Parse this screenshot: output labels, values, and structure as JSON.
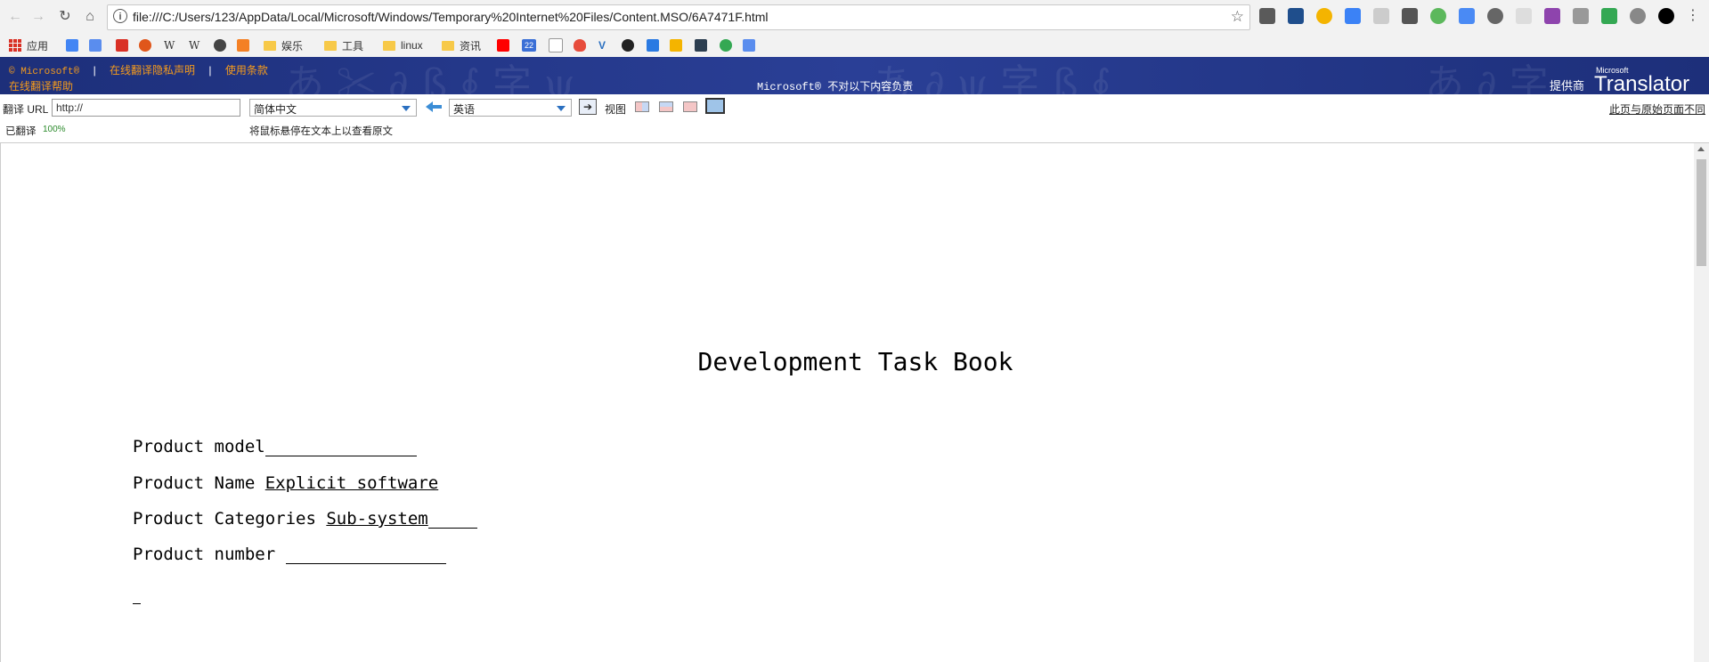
{
  "browser": {
    "url": "file:///C:/Users/123/AppData/Local/Microsoft/Windows/Temporary%20Internet%20Files/Content.MSO/6A7471F.html",
    "bookmarks": [
      "应用",
      "娱乐",
      "工具",
      "linux",
      "资讯"
    ],
    "calendar_badge": "22"
  },
  "translator": {
    "copyright": "© Microsoft®",
    "privacy": "在线翻译隐私声明",
    "terms": "使用条款",
    "help": "在线翻译帮助",
    "disclaimer": "Microsoft® 不对以下内容负责",
    "provider": "提供商",
    "brand_small": "Microsoft",
    "brand": "Translator",
    "url_label": "翻译 URL",
    "url_value": "http://",
    "from_lang": "简体中文",
    "to_lang": "英语",
    "go": "➔",
    "view_label": "视图",
    "mismatch": "此页与原始页面不同",
    "translated_label": "已翻译",
    "progress": "100%",
    "hover_hint": "将鼠标悬停在文本上以查看原文"
  },
  "document": {
    "title": "Development Task Book",
    "fields": [
      {
        "label": "Product model",
        "value": ""
      },
      {
        "label": "Product Name",
        "value": "Explicit software"
      },
      {
        "label": "Product Categories",
        "value": "Sub-system"
      },
      {
        "label": "Product number",
        "value": ""
      }
    ]
  }
}
